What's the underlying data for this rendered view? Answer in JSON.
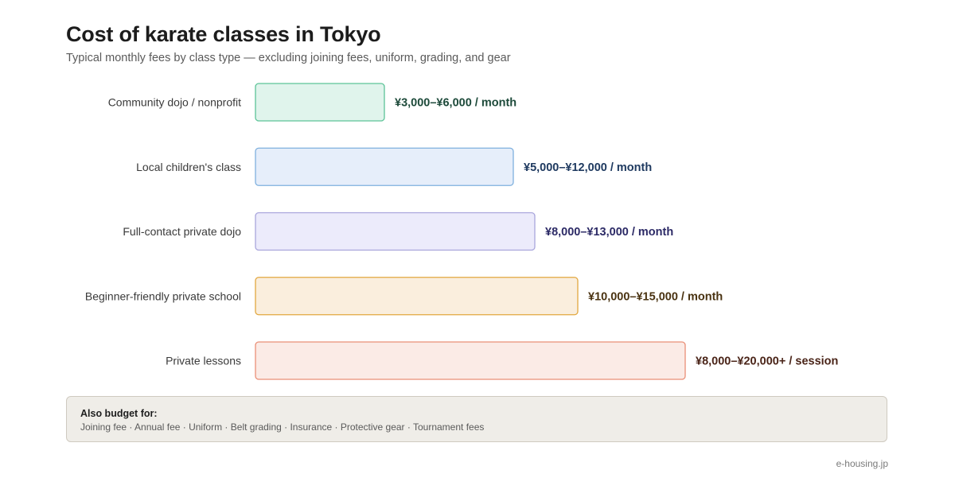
{
  "chart_data": {
    "type": "bar",
    "orientation": "horizontal",
    "title": "Cost of karate classes in Tokyo",
    "subtitle": "Typical monthly fees by class type — excluding joining fees, uniform, grading, and gear",
    "categories": [
      "Community dojo / nonprofit",
      "Local children's class",
      "Full-contact private dojo",
      "Beginner-friendly private school",
      "Private lessons"
    ],
    "value_labels": [
      "¥3,000–¥6,000 / month",
      "¥5,000–¥12,000 / month",
      "¥8,000–¥13,000 / month",
      "¥10,000–¥15,000 / month",
      "¥8,000–¥20,000+ / session"
    ],
    "values": [
      6000,
      12000,
      13000,
      15000,
      20000
    ],
    "series": [
      {
        "name": "",
        "values": [
          6000,
          12000,
          13000,
          15000,
          20000
        ]
      }
    ],
    "colors": [
      {
        "fill": "#e0f4ec",
        "stroke": "#5cc498",
        "text": "#1d4a3a"
      },
      {
        "fill": "#e6eefa",
        "stroke": "#7fb0de",
        "text": "#1f3a60"
      },
      {
        "fill": "#ecebfb",
        "stroke": "#a9a6dc",
        "text": "#2c2a66"
      },
      {
        "fill": "#faeedd",
        "stroke": "#e2a73f",
        "text": "#4a3312"
      },
      {
        "fill": "#fbebe6",
        "stroke": "#ea8f77",
        "text": "#4a2418"
      }
    ],
    "grid": false,
    "legend": "none"
  },
  "budget": {
    "title": "Also budget for:",
    "items": "Joining fee · Annual fee · Uniform · Belt grading · Insurance · Protective gear · Tournament fees"
  },
  "source": "e-housing.jp"
}
